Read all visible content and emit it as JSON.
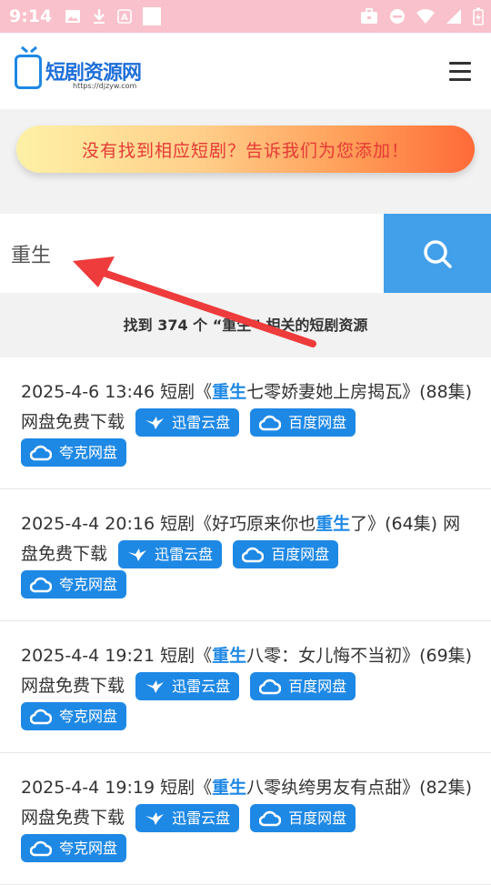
{
  "status_bar": {
    "time": "9:14"
  },
  "header": {
    "logo_text": "短剧资源网",
    "logo_url": "https://djzyw.com"
  },
  "banner": {
    "text": "没有找到相应短剧？告诉我们为您添加！"
  },
  "search": {
    "value": "重生"
  },
  "result_count": "找到 374 个 “重生” 相关的短剧资源",
  "results": [
    {
      "pre": "2025-4-6 13:46 短剧《",
      "highlight": "重生",
      "post": "七零娇妻她上房揭瓦》(88集) 网盘免费下载",
      "tags": [
        "迅雷云盘",
        "百度网盘",
        "夸克网盘"
      ]
    },
    {
      "pre": "2025-4-4 20:16 短剧《好巧原来你也",
      "highlight": "重生",
      "post": "了》(64集) 网盘免费下载",
      "tags": [
        "迅雷云盘",
        "百度网盘",
        "夸克网盘"
      ]
    },
    {
      "pre": "2025-4-4 19:21 短剧《",
      "highlight": "重生",
      "post": "八零：女儿悔不当初》(69集) 网盘免费下载",
      "tags": [
        "迅雷云盘",
        "百度网盘",
        "夸克网盘"
      ]
    },
    {
      "pre": "2025-4-4 19:19 短剧《",
      "highlight": "重生",
      "post": "八零纨绔男友有点甜》(82集) 网盘免费下载",
      "tags": [
        "迅雷云盘",
        "百度网盘",
        "夸克网盘"
      ]
    }
  ],
  "colors": {
    "accent": "#1e88e5",
    "search_button": "#42a0ea",
    "banner_text": "#e53935",
    "status_bar": "#f9c1cb",
    "annotation_arrow": "#ee3b3b"
  },
  "icons": {
    "xunlei": "bird-icon",
    "baidu": "cloud-icon",
    "quark": "cloud-icon"
  }
}
